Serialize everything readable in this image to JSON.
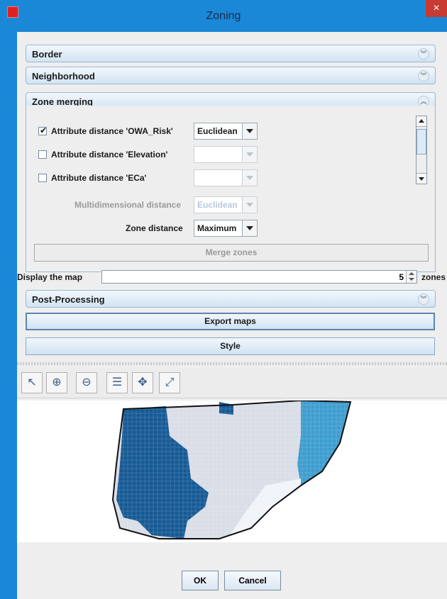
{
  "window": {
    "title": "Zoning",
    "close_glyph": "×",
    "app_icon": "app-logo-icon"
  },
  "sections": {
    "border": {
      "label": "Border",
      "state": "collapsed"
    },
    "neighborhood": {
      "label": "Neighborhood",
      "state": "collapsed"
    },
    "zone_merging": {
      "label": "Zone merging",
      "state": "expanded"
    },
    "post_processing": {
      "label": "Post-Processing",
      "state": "collapsed"
    }
  },
  "zone_merging": {
    "attributes": [
      {
        "label": "Attribute distance 'OWA_Risk'",
        "checked": true,
        "metric": "Euclidean"
      },
      {
        "label": "Attribute distance 'Elevation'",
        "checked": false,
        "metric": ""
      },
      {
        "label": "Attribute distance 'ECa'",
        "checked": false,
        "metric": ""
      }
    ],
    "multidimensional_label": "Multidimensional distance",
    "multidimensional_value": "Euclidean",
    "zone_distance_label": "Zone distance",
    "zone_distance_value": "Maximum",
    "merge_button": "Merge zones",
    "check_glyph": "✔"
  },
  "display": {
    "label": "Display the map",
    "value": "5",
    "unit": "zones"
  },
  "buttons": {
    "export": "Export maps",
    "style": "Style",
    "ok": "OK",
    "cancel": "Cancel"
  },
  "toolbar": {
    "tools": [
      {
        "name": "pointer-icon",
        "glyph": "↖"
      },
      {
        "name": "zoom-in-icon",
        "glyph": "⊕"
      },
      {
        "name": "zoom-out-icon",
        "glyph": "⊖"
      },
      {
        "name": "layer-select-icon",
        "glyph": "☰"
      },
      {
        "name": "pan-icon",
        "glyph": "✥"
      },
      {
        "name": "zoom-extent-icon",
        "glyph": "⤢"
      }
    ]
  },
  "colors": {
    "zone_dark_blue": "#165a94",
    "zone_light_gray": "#d9dde6",
    "zone_light_blue": "#3d9dcf",
    "zone_white": "#f0f4fa"
  }
}
